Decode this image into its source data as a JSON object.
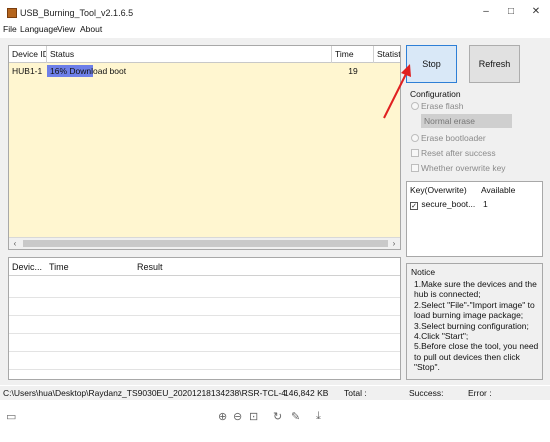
{
  "window": {
    "title": "USB_Burning_Tool_v2.1.6.5",
    "minimize_glyph": "–",
    "maximize_glyph": "□",
    "close_glyph": "✕"
  },
  "menu": [
    "File",
    "Language",
    "View",
    "About"
  ],
  "device_table": {
    "columns": [
      "Device ID",
      "Status",
      "Time",
      "Statisti"
    ],
    "rows": [
      {
        "device_id": "HUB1-1",
        "status": "16% Download boot",
        "progress": 0.16,
        "time": "19"
      }
    ]
  },
  "result_table": {
    "columns": [
      "Devic...",
      "Time",
      "Result"
    ]
  },
  "buttons": {
    "stop": "Stop",
    "refresh": "Refresh"
  },
  "configuration": {
    "title": "Configuration",
    "erase_flash": "Erase flash",
    "erase_mode": "Normal erase",
    "erase_bootloader": "Erase bootloader",
    "reset_after_success": "Reset after success",
    "whether_overwrite_key": "Whether overwrite key"
  },
  "key_list": {
    "col_key": "Key(Overwrite)",
    "col_available": "Available",
    "rows": [
      {
        "name": "secure_boot...",
        "available": "1",
        "checked": true
      }
    ]
  },
  "notice": {
    "title": "Notice",
    "text": "1.Make sure the devices and the hub is connected;\n2.Select \"File\"-\"Import image\" to load burning image package;\n3.Select burning configuration;\n4.Click \"Start\";\n5.Before close the tool, you need to pull out devices then click \"Stop\"."
  },
  "status_bar": {
    "path": "C:\\Users\\hua\\Desktop\\Raydanz_TS9030EU_20201218134238\\RSR-TCL-4",
    "size": "146,842 KB",
    "total": "Total :",
    "success": "Success:",
    "error": "Error :"
  },
  "viewer_toolbar": {
    "icons": [
      "save-icon",
      "zoom-in-icon",
      "zoom-out-icon",
      "fit-page-icon",
      "rotate-icon",
      "edit-icon",
      "download-icon"
    ]
  },
  "colors": {
    "annotation_arrow": "#e02020",
    "progress": "#6e7fe8",
    "device_table_bg": "#fff6d0"
  }
}
